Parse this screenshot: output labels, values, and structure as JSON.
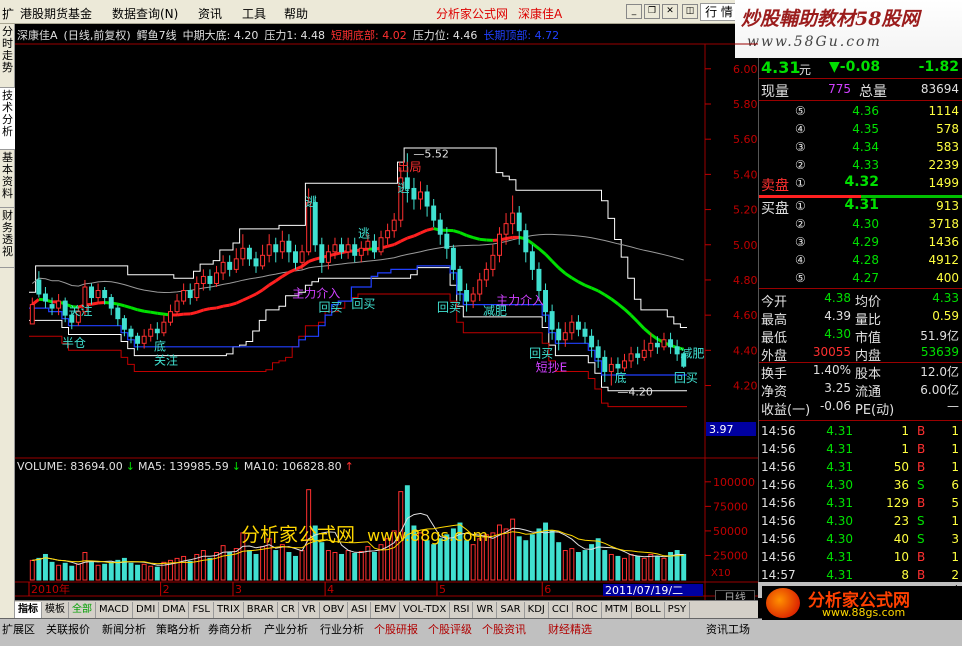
{
  "menu": {
    "items": [
      "扩",
      "港股期货基金",
      "数据查询(N)",
      "资讯",
      "工具",
      "帮助"
    ],
    "app_title": "分析家公式网",
    "stock_name": "深康佳A",
    "quote_button": "行 情"
  },
  "banner": {
    "line1": "炒股輔助教材58股网",
    "line2": "www.58Gu.com"
  },
  "left_tabs": [
    "分时走势",
    "技术分析",
    "基本资料",
    "财务透视"
  ],
  "chart": {
    "info": [
      {
        "t": "深康佳A",
        "c": "#e0e0e0"
      },
      {
        "t": "(日线,前复权)",
        "c": "#e0e0e0"
      },
      {
        "t": "鳄鱼7线",
        "c": "#e0e0e0"
      },
      {
        "t": "中期大底: 4.20",
        "c": "#e0e0e0"
      },
      {
        "t": "压力1: 4.48",
        "c": "#e0e0e0"
      },
      {
        "t": "短期底部: 4.02",
        "c": "#ff3030"
      },
      {
        "t": "压力位: 4.46",
        "c": "#e0e0e0"
      },
      {
        "t": "长期顶部: 4.72",
        "c": "#2040ff"
      }
    ],
    "price_axis": [
      "6.00",
      "5.80",
      "5.60",
      "5.40",
      "5.20",
      "5.00",
      "4.80",
      "4.60",
      "4.40",
      "4.20"
    ],
    "low_marker": "3.97",
    "high_label": "5.52",
    "low_label": "4.20",
    "annotations": [
      {
        "t": "半仓",
        "c": "#40e0d0"
      },
      {
        "t": "关注",
        "c": "#40e0d0"
      },
      {
        "t": "底",
        "c": "#40e0d0"
      },
      {
        "t": "关注",
        "c": "#40e0d0"
      },
      {
        "t": "主力介入",
        "c": "#d040ff"
      },
      {
        "t": "回买",
        "c": "#40e0d0"
      },
      {
        "t": "回买",
        "c": "#40e0d0"
      },
      {
        "t": "逃",
        "c": "#40e0d0"
      },
      {
        "t": "逃",
        "c": "#40e0d0"
      },
      {
        "t": "逃",
        "c": "#40e0d0"
      },
      {
        "t": "出局",
        "c": "#ff3030"
      },
      {
        "t": "回买",
        "c": "#40e0d0"
      },
      {
        "t": "主力介入",
        "c": "#d040ff"
      },
      {
        "t": "减肥",
        "c": "#40e0d0"
      },
      {
        "t": "回买",
        "c": "#40e0d0"
      },
      {
        "t": "短抄E",
        "c": "#d040ff"
      },
      {
        "t": "底",
        "c": "#40e0d0"
      },
      {
        "t": "回买",
        "c": "#40e0d0"
      },
      {
        "t": "减肥",
        "c": "#40e0d0"
      }
    ],
    "volume_info": [
      {
        "t": "VOLUME: 83694.00",
        "c": "#e0e0e0"
      },
      {
        "t": "↓",
        "c": "#00e000"
      },
      {
        "t": "MA5: 139985.59",
        "c": "#e0e0e0"
      },
      {
        "t": "↓",
        "c": "#00e000"
      },
      {
        "t": "MA10: 106828.80",
        "c": "#e0e0e0"
      },
      {
        "t": "↑",
        "c": "#ff3030"
      }
    ],
    "volume_axis": [
      "100000",
      "75000",
      "50000",
      "25000"
    ],
    "volume_unit": "X10",
    "date_axis": [
      "2010年",
      "2",
      "3",
      "4",
      "5",
      "6"
    ],
    "cursor_date": "2011/07/19/二",
    "watermark_text": "分析家公式网",
    "watermark_url": "www.88gs.com",
    "scale_label": "日线"
  },
  "chart_data": {
    "type": "candlestick",
    "ylim": [
      3.97,
      6.05
    ],
    "candles": [
      [
        4.55,
        4.66,
        4.6,
        4.7
      ],
      [
        4.8,
        4.72,
        4.7,
        4.85
      ],
      [
        4.72,
        4.68,
        4.64,
        4.76
      ],
      [
        4.66,
        4.64,
        4.6,
        4.7
      ],
      [
        4.64,
        4.68,
        4.6,
        4.72
      ],
      [
        4.68,
        4.6,
        4.56,
        4.7
      ],
      [
        4.6,
        4.56,
        4.52,
        4.62
      ],
      [
        4.56,
        4.62,
        4.54,
        4.65
      ],
      [
        4.62,
        4.76,
        4.6,
        4.8
      ],
      [
        4.76,
        4.7,
        4.66,
        4.78
      ],
      [
        4.7,
        4.74,
        4.67,
        4.78
      ],
      [
        4.74,
        4.7,
        4.66,
        4.76
      ],
      [
        4.7,
        4.64,
        4.6,
        4.72
      ],
      [
        4.64,
        4.58,
        4.54,
        4.66
      ],
      [
        4.58,
        4.52,
        4.48,
        4.6
      ],
      [
        4.52,
        4.48,
        4.44,
        4.54
      ],
      [
        4.48,
        4.44,
        4.4,
        4.5
      ],
      [
        4.44,
        4.48,
        4.41,
        4.52
      ],
      [
        4.48,
        4.52,
        4.45,
        4.55
      ],
      [
        4.52,
        4.5,
        4.46,
        4.56
      ],
      [
        4.5,
        4.56,
        4.48,
        4.6
      ],
      [
        4.56,
        4.62,
        4.54,
        4.66
      ],
      [
        4.62,
        4.68,
        4.6,
        4.72
      ],
      [
        4.68,
        4.74,
        4.66,
        4.78
      ],
      [
        4.74,
        4.7,
        4.66,
        4.78
      ],
      [
        4.7,
        4.78,
        4.68,
        4.82
      ],
      [
        4.78,
        4.82,
        4.74,
        4.86
      ],
      [
        4.82,
        4.78,
        4.74,
        4.86
      ],
      [
        4.78,
        4.84,
        4.76,
        4.88
      ],
      [
        4.84,
        4.9,
        4.8,
        4.94
      ],
      [
        4.9,
        4.86,
        4.82,
        4.94
      ],
      [
        4.86,
        4.92,
        4.84,
        4.98
      ],
      [
        4.92,
        4.98,
        4.88,
        5.06
      ],
      [
        4.98,
        4.92,
        4.88,
        5.0
      ],
      [
        4.92,
        4.88,
        4.84,
        4.96
      ],
      [
        4.88,
        4.94,
        4.86,
        5.0
      ],
      [
        4.94,
        5.0,
        4.9,
        5.06
      ],
      [
        5.0,
        4.96,
        4.9,
        5.04
      ],
      [
        4.96,
        5.02,
        4.92,
        5.08
      ],
      [
        5.02,
        4.96,
        4.9,
        5.06
      ],
      [
        4.96,
        4.9,
        4.86,
        5.0
      ],
      [
        4.9,
        4.96,
        4.86,
        5.0
      ],
      [
        4.96,
        5.24,
        4.94,
        5.32
      ],
      [
        5.24,
        5.0,
        4.96,
        5.28
      ],
      [
        5.0,
        4.9,
        4.84,
        5.04
      ],
      [
        4.9,
        4.96,
        4.86,
        5.0
      ],
      [
        4.96,
        5.0,
        4.92,
        5.04
      ],
      [
        5.0,
        4.96,
        4.92,
        5.04
      ],
      [
        4.96,
        5.0,
        4.92,
        5.04
      ],
      [
        5.0,
        4.94,
        4.9,
        5.04
      ],
      [
        4.94,
        4.98,
        4.9,
        5.02
      ],
      [
        4.98,
        5.02,
        4.94,
        5.06
      ],
      [
        5.02,
        4.96,
        4.92,
        5.06
      ],
      [
        4.96,
        5.04,
        4.94,
        5.08
      ],
      [
        5.04,
        5.08,
        5.0,
        5.12
      ],
      [
        5.08,
        5.14,
        5.04,
        5.18
      ],
      [
        5.14,
        5.38,
        5.1,
        5.44
      ],
      [
        5.38,
        5.32,
        5.24,
        5.52
      ],
      [
        5.32,
        5.26,
        5.2,
        5.38
      ],
      [
        5.26,
        5.3,
        5.2,
        5.36
      ],
      [
        5.3,
        5.22,
        5.16,
        5.34
      ],
      [
        5.22,
        5.14,
        5.1,
        5.26
      ],
      [
        5.14,
        5.06,
        5.0,
        5.18
      ],
      [
        5.06,
        4.98,
        4.92,
        5.1
      ],
      [
        4.98,
        4.86,
        4.8,
        5.0
      ],
      [
        4.86,
        4.74,
        4.68,
        4.88
      ],
      [
        4.74,
        4.68,
        4.62,
        4.78
      ],
      [
        4.68,
        4.72,
        4.64,
        4.76
      ],
      [
        4.72,
        4.8,
        4.68,
        4.84
      ],
      [
        4.8,
        4.86,
        4.76,
        4.9
      ],
      [
        4.86,
        4.94,
        4.82,
        5.0
      ],
      [
        4.94,
        5.06,
        4.9,
        5.1
      ],
      [
        5.06,
        5.12,
        5.0,
        5.18
      ],
      [
        5.12,
        5.18,
        5.06,
        5.28
      ],
      [
        5.18,
        5.08,
        5.0,
        5.22
      ],
      [
        5.08,
        4.96,
        4.9,
        5.12
      ],
      [
        4.96,
        4.86,
        4.8,
        5.0
      ],
      [
        4.86,
        4.74,
        4.68,
        4.9
      ],
      [
        4.74,
        4.62,
        4.56,
        4.78
      ],
      [
        4.62,
        4.52,
        4.46,
        4.66
      ],
      [
        4.52,
        4.46,
        4.4,
        4.56
      ],
      [
        4.46,
        4.5,
        4.42,
        4.56
      ],
      [
        4.5,
        4.56,
        4.46,
        4.6
      ],
      [
        4.56,
        4.52,
        4.48,
        4.6
      ],
      [
        4.52,
        4.48,
        4.44,
        4.56
      ],
      [
        4.48,
        4.42,
        4.36,
        4.52
      ],
      [
        4.42,
        4.36,
        4.3,
        4.46
      ],
      [
        4.36,
        4.28,
        4.22,
        4.4
      ],
      [
        4.28,
        4.32,
        4.2,
        4.36
      ],
      [
        4.32,
        4.3,
        4.26,
        4.36
      ],
      [
        4.3,
        4.34,
        4.28,
        4.38
      ],
      [
        4.34,
        4.38,
        4.3,
        4.42
      ],
      [
        4.38,
        4.36,
        4.32,
        4.42
      ],
      [
        4.36,
        4.4,
        4.34,
        4.46
      ],
      [
        4.4,
        4.44,
        4.36,
        4.5
      ],
      [
        4.44,
        4.42,
        4.38,
        4.48
      ],
      [
        4.42,
        4.46,
        4.4,
        4.5
      ],
      [
        4.46,
        4.42,
        4.38,
        4.5
      ],
      [
        4.42,
        4.38,
        4.34,
        4.46
      ],
      [
        4.38,
        4.31,
        4.3,
        4.39
      ]
    ],
    "volume": [
      20000,
      22000,
      26000,
      18000,
      15000,
      17000,
      14000,
      16000,
      28000,
      19000,
      15000,
      16000,
      18000,
      20000,
      22000,
      17000,
      15000,
      16000,
      14000,
      13000,
      18000,
      20000,
      22000,
      24000,
      19000,
      26000,
      30000,
      22000,
      28000,
      35000,
      28000,
      32000,
      48000,
      30000,
      26000,
      34000,
      42000,
      30000,
      36000,
      28000,
      24000,
      30000,
      92000,
      55000,
      38000,
      30000,
      28000,
      26000,
      30000,
      27000,
      29000,
      34000,
      28000,
      36000,
      42000,
      50000,
      90000,
      96000,
      55000,
      48000,
      40000,
      36000,
      42000,
      46000,
      52000,
      58000,
      40000,
      36000,
      42000,
      46000,
      48000,
      56000,
      52000,
      62000,
      44000,
      40000,
      46000,
      52000,
      58000,
      50000,
      38000,
      30000,
      32000,
      28000,
      30000,
      36000,
      42000,
      30000,
      26000,
      24000,
      22000,
      26000,
      24000,
      22000,
      26000,
      24000,
      22000,
      28000,
      30000,
      26000
    ]
  },
  "quote": {
    "price": "4.31",
    "price_unit": "元",
    "change": "▼-0.08",
    "pct": "-1.82",
    "xianliang_label": "现量",
    "xianliang": "775",
    "zongliang_label": "总量",
    "zongliang": "83694",
    "sell": [
      {
        "lv": "⑤",
        "p": "4.36",
        "v": "1114"
      },
      {
        "lv": "④",
        "p": "4.35",
        "v": "578"
      },
      {
        "lv": "③",
        "p": "4.34",
        "v": "583"
      },
      {
        "lv": "②",
        "p": "4.33",
        "v": "2239"
      },
      {
        "lv": "①",
        "p": "4.32",
        "v": "1499"
      }
    ],
    "sell_label": "卖盘",
    "buy_label": "买盘",
    "buy": [
      {
        "lv": "①",
        "p": "4.31",
        "v": "913"
      },
      {
        "lv": "②",
        "p": "4.30",
        "v": "3718"
      },
      {
        "lv": "③",
        "p": "4.29",
        "v": "1436"
      },
      {
        "lv": "④",
        "p": "4.28",
        "v": "4912"
      },
      {
        "lv": "⑤",
        "p": "4.27",
        "v": "400"
      }
    ],
    "stats": [
      [
        {
          "l": "今开",
          "v": "4.38",
          "c": "green"
        },
        {
          "l": "均价",
          "v": "4.33",
          "c": "green"
        }
      ],
      [
        {
          "l": "最高",
          "v": "4.39",
          "c": "white"
        },
        {
          "l": "量比",
          "v": "0.59",
          "c": "yellow"
        }
      ],
      [
        {
          "l": "最低",
          "v": "4.30",
          "c": "green"
        },
        {
          "l": "市值",
          "v": "51.9亿",
          "c": "white"
        }
      ],
      [
        {
          "l": "外盘",
          "v": "30055",
          "c": "red"
        },
        {
          "l": "内盘",
          "v": "53639",
          "c": "green"
        }
      ],
      [
        {
          "l": "换手",
          "v": "1.40%",
          "c": "white"
        },
        {
          "l": "股本",
          "v": "12.0亿",
          "c": "white"
        }
      ],
      [
        {
          "l": "净资",
          "v": "3.25",
          "c": "white"
        },
        {
          "l": "流通",
          "v": "6.00亿",
          "c": "white"
        }
      ],
      [
        {
          "l": "收益(一)",
          "v": "-0.06",
          "c": "white"
        },
        {
          "l": "PE(动)",
          "v": "—",
          "c": "white"
        }
      ]
    ],
    "ticks": [
      {
        "t": "14:56",
        "p": "4.31",
        "v": "1",
        "d": "B",
        "n": "1"
      },
      {
        "t": "14:56",
        "p": "4.31",
        "v": "1",
        "d": "B",
        "n": "1"
      },
      {
        "t": "14:56",
        "p": "4.31",
        "v": "50",
        "d": "B",
        "n": "1"
      },
      {
        "t": "14:56",
        "p": "4.30",
        "v": "36",
        "d": "S",
        "n": "6"
      },
      {
        "t": "14:56",
        "p": "4.31",
        "v": "129",
        "d": "B",
        "n": "5"
      },
      {
        "t": "14:56",
        "p": "4.30",
        "v": "23",
        "d": "S",
        "n": "1"
      },
      {
        "t": "14:56",
        "p": "4.30",
        "v": "40",
        "d": "S",
        "n": "3"
      },
      {
        "t": "14:56",
        "p": "4.31",
        "v": "10",
        "d": "B",
        "n": "1"
      },
      {
        "t": "14:57",
        "p": "4.31",
        "v": "8",
        "d": "B",
        "n": "2"
      }
    ]
  },
  "indicator_tabs": [
    "指标",
    "模板",
    "全部",
    "MACD",
    "DMI",
    "DMA",
    "FSL",
    "TRIX",
    "BRAR",
    "CR",
    "VR",
    "OBV",
    "ASI",
    "EMV",
    "VOL-TDX",
    "RSI",
    "WR",
    "SAR",
    "KDJ",
    "CCI",
    "ROC",
    "MTM",
    "BOLL",
    "PSY"
  ],
  "bottom_nav": [
    "扩展区",
    "关联报价",
    "新闻分析",
    "策略分析",
    "券商分析",
    "产业分析",
    "行业分析",
    "个股研报",
    "个股评级",
    "个股资讯",
    "财经精选",
    "资讯工场"
  ],
  "logo": {
    "name": "分析家公式网",
    "url": "www.88gs.com"
  },
  "colors": {
    "up": "#ff3030",
    "down": "#40e0d0",
    "ma_green": "#00e000",
    "ma_red": "#ff2020",
    "channel": "#ffffff",
    "support": "#c00000",
    "blue_line": "#2040ff"
  }
}
